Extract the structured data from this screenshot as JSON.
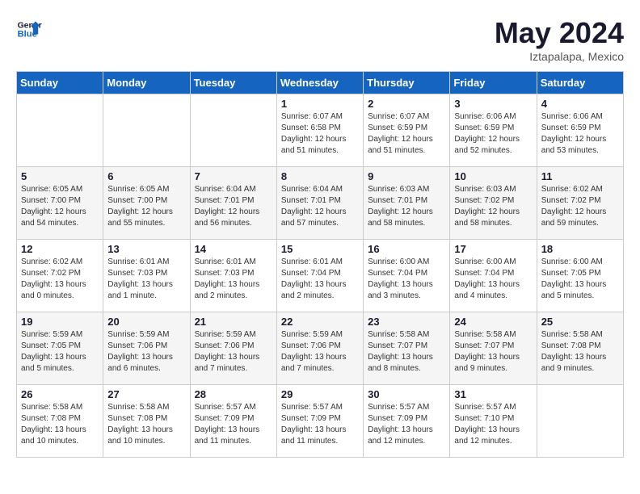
{
  "logo": {
    "line1": "General",
    "line2": "Blue"
  },
  "title": "May 2024",
  "location": "Iztapalapa, Mexico",
  "days_header": [
    "Sunday",
    "Monday",
    "Tuesday",
    "Wednesday",
    "Thursday",
    "Friday",
    "Saturday"
  ],
  "weeks": [
    [
      {
        "day": "",
        "info": ""
      },
      {
        "day": "",
        "info": ""
      },
      {
        "day": "",
        "info": ""
      },
      {
        "day": "1",
        "info": "Sunrise: 6:07 AM\nSunset: 6:58 PM\nDaylight: 12 hours\nand 51 minutes."
      },
      {
        "day": "2",
        "info": "Sunrise: 6:07 AM\nSunset: 6:59 PM\nDaylight: 12 hours\nand 51 minutes."
      },
      {
        "day": "3",
        "info": "Sunrise: 6:06 AM\nSunset: 6:59 PM\nDaylight: 12 hours\nand 52 minutes."
      },
      {
        "day": "4",
        "info": "Sunrise: 6:06 AM\nSunset: 6:59 PM\nDaylight: 12 hours\nand 53 minutes."
      }
    ],
    [
      {
        "day": "5",
        "info": "Sunrise: 6:05 AM\nSunset: 7:00 PM\nDaylight: 12 hours\nand 54 minutes."
      },
      {
        "day": "6",
        "info": "Sunrise: 6:05 AM\nSunset: 7:00 PM\nDaylight: 12 hours\nand 55 minutes."
      },
      {
        "day": "7",
        "info": "Sunrise: 6:04 AM\nSunset: 7:01 PM\nDaylight: 12 hours\nand 56 minutes."
      },
      {
        "day": "8",
        "info": "Sunrise: 6:04 AM\nSunset: 7:01 PM\nDaylight: 12 hours\nand 57 minutes."
      },
      {
        "day": "9",
        "info": "Sunrise: 6:03 AM\nSunset: 7:01 PM\nDaylight: 12 hours\nand 58 minutes."
      },
      {
        "day": "10",
        "info": "Sunrise: 6:03 AM\nSunset: 7:02 PM\nDaylight: 12 hours\nand 58 minutes."
      },
      {
        "day": "11",
        "info": "Sunrise: 6:02 AM\nSunset: 7:02 PM\nDaylight: 12 hours\nand 59 minutes."
      }
    ],
    [
      {
        "day": "12",
        "info": "Sunrise: 6:02 AM\nSunset: 7:02 PM\nDaylight: 13 hours\nand 0 minutes."
      },
      {
        "day": "13",
        "info": "Sunrise: 6:01 AM\nSunset: 7:03 PM\nDaylight: 13 hours\nand 1 minute."
      },
      {
        "day": "14",
        "info": "Sunrise: 6:01 AM\nSunset: 7:03 PM\nDaylight: 13 hours\nand 2 minutes."
      },
      {
        "day": "15",
        "info": "Sunrise: 6:01 AM\nSunset: 7:04 PM\nDaylight: 13 hours\nand 2 minutes."
      },
      {
        "day": "16",
        "info": "Sunrise: 6:00 AM\nSunset: 7:04 PM\nDaylight: 13 hours\nand 3 minutes."
      },
      {
        "day": "17",
        "info": "Sunrise: 6:00 AM\nSunset: 7:04 PM\nDaylight: 13 hours\nand 4 minutes."
      },
      {
        "day": "18",
        "info": "Sunrise: 6:00 AM\nSunset: 7:05 PM\nDaylight: 13 hours\nand 5 minutes."
      }
    ],
    [
      {
        "day": "19",
        "info": "Sunrise: 5:59 AM\nSunset: 7:05 PM\nDaylight: 13 hours\nand 5 minutes."
      },
      {
        "day": "20",
        "info": "Sunrise: 5:59 AM\nSunset: 7:06 PM\nDaylight: 13 hours\nand 6 minutes."
      },
      {
        "day": "21",
        "info": "Sunrise: 5:59 AM\nSunset: 7:06 PM\nDaylight: 13 hours\nand 7 minutes."
      },
      {
        "day": "22",
        "info": "Sunrise: 5:59 AM\nSunset: 7:06 PM\nDaylight: 13 hours\nand 7 minutes."
      },
      {
        "day": "23",
        "info": "Sunrise: 5:58 AM\nSunset: 7:07 PM\nDaylight: 13 hours\nand 8 minutes."
      },
      {
        "day": "24",
        "info": "Sunrise: 5:58 AM\nSunset: 7:07 PM\nDaylight: 13 hours\nand 9 minutes."
      },
      {
        "day": "25",
        "info": "Sunrise: 5:58 AM\nSunset: 7:08 PM\nDaylight: 13 hours\nand 9 minutes."
      }
    ],
    [
      {
        "day": "26",
        "info": "Sunrise: 5:58 AM\nSunset: 7:08 PM\nDaylight: 13 hours\nand 10 minutes."
      },
      {
        "day": "27",
        "info": "Sunrise: 5:58 AM\nSunset: 7:08 PM\nDaylight: 13 hours\nand 10 minutes."
      },
      {
        "day": "28",
        "info": "Sunrise: 5:57 AM\nSunset: 7:09 PM\nDaylight: 13 hours\nand 11 minutes."
      },
      {
        "day": "29",
        "info": "Sunrise: 5:57 AM\nSunset: 7:09 PM\nDaylight: 13 hours\nand 11 minutes."
      },
      {
        "day": "30",
        "info": "Sunrise: 5:57 AM\nSunset: 7:09 PM\nDaylight: 13 hours\nand 12 minutes."
      },
      {
        "day": "31",
        "info": "Sunrise: 5:57 AM\nSunset: 7:10 PM\nDaylight: 13 hours\nand 12 minutes."
      },
      {
        "day": "",
        "info": ""
      }
    ]
  ]
}
